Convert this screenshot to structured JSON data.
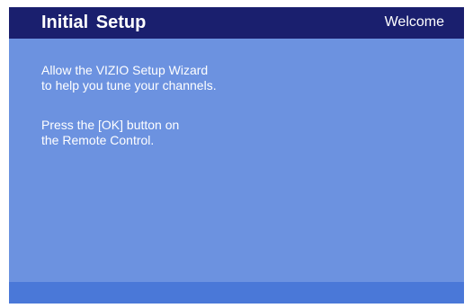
{
  "header": {
    "title": "Initial  Setup",
    "step": "Welcome"
  },
  "content": {
    "paragraph1": [
      "Allow the VIZIO Setup Wizard",
      "to help you tune your channels."
    ],
    "paragraph2": [
      "Press the [OK] button on",
      "the Remote Control."
    ]
  },
  "colors": {
    "background": "#6c92e0",
    "header": "#1a1f6e",
    "footer": "#4a78d8",
    "text": "#ffffff"
  }
}
